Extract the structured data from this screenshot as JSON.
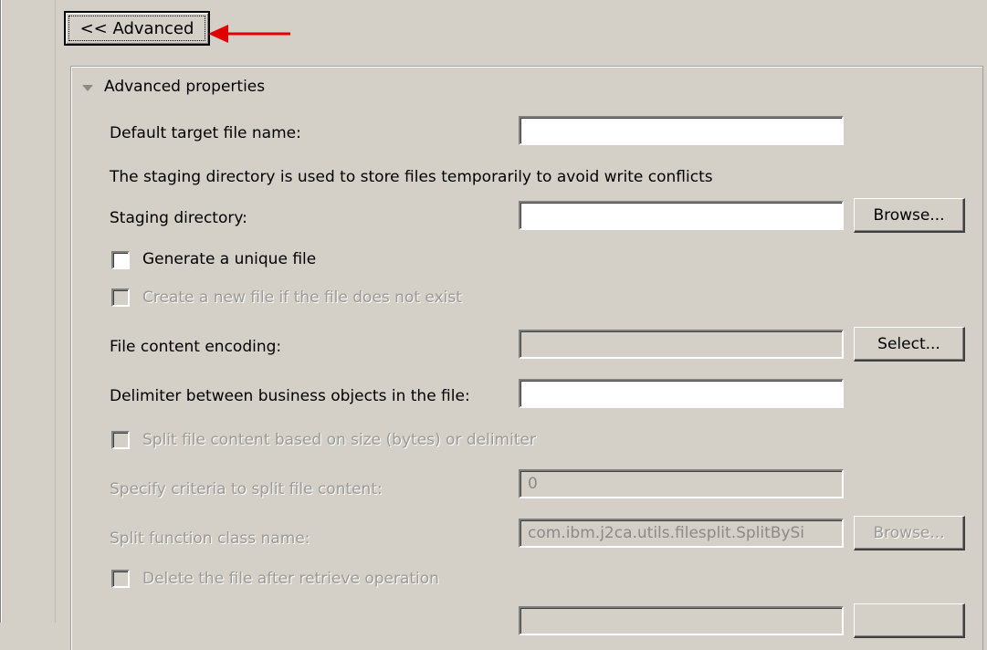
{
  "advanced_button": {
    "label": "<< Advanced"
  },
  "group": {
    "title": "Advanced properties"
  },
  "fields": {
    "default_target_file_name": {
      "label": "Default target file name:",
      "value": ""
    },
    "staging_note": "The staging directory is used to store files temporarily to avoid write conflicts",
    "staging_directory": {
      "label": "Staging directory:",
      "value": "",
      "button": "Browse..."
    },
    "generate_unique_file": {
      "label": "Generate a unique file",
      "checked": false
    },
    "create_new_file": {
      "label": "Create a new file if the file does not exist",
      "checked": false
    },
    "file_content_encoding": {
      "label": "File content encoding:",
      "value": "",
      "button": "Select..."
    },
    "delimiter": {
      "label": "Delimiter between business objects in the file:",
      "value": ""
    },
    "split_file_content": {
      "label": "Split file content based on size (bytes) or delimiter",
      "checked": false
    },
    "split_criteria": {
      "label": "Specify criteria to split file content:",
      "value": "0"
    },
    "split_function_class": {
      "label": "Split function class name:",
      "value": "com.ibm.j2ca.utils.filesplit.SplitBySi",
      "button": "Browse..."
    },
    "delete_after_retrieve": {
      "label": "Delete the file after retrieve operation",
      "checked": false
    }
  },
  "colors": {
    "arrow": "#e00000",
    "background": "#d4d0c8",
    "disabled_text": "#9c9a96"
  }
}
